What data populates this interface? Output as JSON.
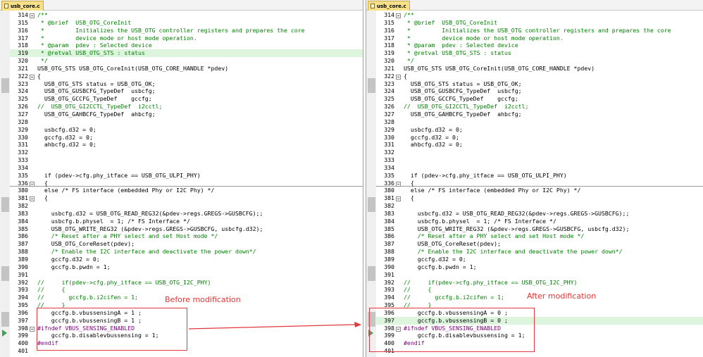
{
  "left_pane": {
    "tab_label": "usb_core.c",
    "lines": [
      {
        "n": "314",
        "text": "/**",
        "cls": "comment",
        "fold": true
      },
      {
        "n": "315",
        "text": " * @brief  USB_OTG_CoreInit",
        "cls": "comment"
      },
      {
        "n": "316",
        "text": " *         Initializes the USB_OTG controller registers and prepares the core",
        "cls": "comment"
      },
      {
        "n": "317",
        "text": " *         device mode or host mode operation.",
        "cls": "comment"
      },
      {
        "n": "318",
        "text": " * @param  pdev : Selected device",
        "cls": "comment"
      },
      {
        "n": "319",
        "text": " * @retval USB_OTG_STS : status",
        "cls": "comment",
        "hl": true
      },
      {
        "n": "320",
        "text": " */",
        "cls": "comment"
      },
      {
        "n": "321",
        "text": "USB_OTG_STS USB_OTG_CoreInit(USB_OTG_CORE_HANDLE *pdev)",
        "cls": ""
      },
      {
        "n": "322",
        "text": "{",
        "cls": "",
        "fold": true
      },
      {
        "n": "323",
        "text": "  USB_OTG_STS status = USB_OTG_OK;",
        "cls": ""
      },
      {
        "n": "324",
        "text": "  USB_OTG_GUSBCFG_TypeDef  usbcfg;",
        "cls": ""
      },
      {
        "n": "325",
        "text": "  USB_OTG_GCCFG_TypeDef    gccfg;",
        "cls": ""
      },
      {
        "n": "326",
        "text": "//  USB_OTG_GI2CCTL_TypeDef  i2cctl;",
        "cls": "comment"
      },
      {
        "n": "327",
        "text": "  USB_OTG_GAHBCFG_TypeDef  ahbcfg;",
        "cls": ""
      },
      {
        "n": "328",
        "text": "",
        "cls": ""
      },
      {
        "n": "329",
        "text": "  usbcfg.d32 = 0;",
        "cls": ""
      },
      {
        "n": "330",
        "text": "  gccfg.d32 = 0;",
        "cls": ""
      },
      {
        "n": "331",
        "text": "  ahbcfg.d32 = 0;",
        "cls": ""
      },
      {
        "n": "332",
        "text": "",
        "cls": ""
      },
      {
        "n": "333",
        "text": "",
        "cls": ""
      },
      {
        "n": "334",
        "text": "",
        "cls": ""
      },
      {
        "n": "335",
        "text": "  if (pdev->cfg.phy_itface == USB_OTG_ULPI_PHY)",
        "cls": ""
      },
      {
        "n": "336",
        "text": "  {",
        "cls": "",
        "fold": true,
        "sep": true
      },
      {
        "n": "380",
        "text": "  else /* FS interface (embedded Phy or I2C Phy) */",
        "cls": ""
      },
      {
        "n": "381",
        "text": "  {",
        "cls": "",
        "fold": true
      },
      {
        "n": "382",
        "text": "",
        "cls": ""
      },
      {
        "n": "383",
        "text": "    usbcfg.d32 = USB_OTG_READ_REG32(&pdev->regs.GREGS->GUSBCFG);;",
        "cls": ""
      },
      {
        "n": "384",
        "text": "    usbcfg.b.physel  = 1; /* FS Interface */",
        "cls": ""
      },
      {
        "n": "385",
        "text": "    USB_OTG_WRITE_REG32 (&pdev->regs.GREGS->GUSBCFG, usbcfg.d32);",
        "cls": ""
      },
      {
        "n": "386",
        "text": "    /* Reset after a PHY select and set Host mode */",
        "cls": "comment"
      },
      {
        "n": "387",
        "text": "    USB_OTG_CoreReset(pdev);",
        "cls": ""
      },
      {
        "n": "388",
        "text": "    /* Enable the I2C interface and deactivate the power down*/",
        "cls": "comment"
      },
      {
        "n": "389",
        "text": "    gccfg.d32 = 0;",
        "cls": ""
      },
      {
        "n": "390",
        "text": "    gccfg.b.pwdn = 1;",
        "cls": ""
      },
      {
        "n": "391",
        "text": "",
        "cls": ""
      },
      {
        "n": "392",
        "text": "//     if(pdev->cfg.phy_itface == USB_OTG_I2C_PHY)",
        "cls": "comment"
      },
      {
        "n": "393",
        "text": "//     {",
        "cls": "comment"
      },
      {
        "n": "394",
        "text": "//       gccfg.b.i2cifen = 1;",
        "cls": "comment"
      },
      {
        "n": "395",
        "text": "//     }",
        "cls": "comment"
      },
      {
        "n": "396",
        "text": "    gccfg.b.vbussensingA = 1 ;",
        "cls": ""
      },
      {
        "n": "397",
        "text": "    gccfg.b.vbussensingB = 1 ;",
        "cls": ""
      },
      {
        "n": "398",
        "text": "#ifndef VBUS_SENSING_ENABLED",
        "cls": "preproc",
        "fold": true
      },
      {
        "n": "399",
        "text": "    gccfg.b.disablevbussensing = 1;",
        "cls": ""
      },
      {
        "n": "400",
        "text": "#endif",
        "cls": "preproc"
      },
      {
        "n": "401",
        "text": "",
        "cls": ""
      }
    ],
    "annotation": "Before modification"
  },
  "right_pane": {
    "tab_label": "usb_core.c",
    "lines": [
      {
        "n": "314",
        "text": "/**",
        "cls": "comment",
        "fold": true
      },
      {
        "n": "315",
        "text": " * @brief  USB_OTG_CoreInit",
        "cls": "comment"
      },
      {
        "n": "316",
        "text": " *         Initializes the USB_OTG controller registers and prepares the core",
        "cls": "comment"
      },
      {
        "n": "317",
        "text": " *         device mode or host mode operation.",
        "cls": "comment"
      },
      {
        "n": "318",
        "text": " * @param  pdev : Selected device",
        "cls": "comment"
      },
      {
        "n": "319",
        "text": " * @retval USB_OTG_STS : status",
        "cls": "comment"
      },
      {
        "n": "320",
        "text": " */",
        "cls": "comment"
      },
      {
        "n": "321",
        "text": "USB_OTG_STS USB_OTG_CoreInit(USB_OTG_CORE_HANDLE *pdev)",
        "cls": ""
      },
      {
        "n": "322",
        "text": "{",
        "cls": "",
        "fold": true
      },
      {
        "n": "323",
        "text": "  USB_OTG_STS status = USB_OTG_OK;",
        "cls": ""
      },
      {
        "n": "324",
        "text": "  USB_OTG_GUSBCFG_TypeDef  usbcfg;",
        "cls": ""
      },
      {
        "n": "325",
        "text": "  USB_OTG_GCCFG_TypeDef    gccfg;",
        "cls": ""
      },
      {
        "n": "326",
        "text": "//  USB_OTG_GI2CCTL_TypeDef  i2cctl;",
        "cls": "comment"
      },
      {
        "n": "327",
        "text": "  USB_OTG_GAHBCFG_TypeDef  ahbcfg;",
        "cls": ""
      },
      {
        "n": "328",
        "text": "",
        "cls": ""
      },
      {
        "n": "329",
        "text": "  usbcfg.d32 = 0;",
        "cls": ""
      },
      {
        "n": "330",
        "text": "  gccfg.d32 = 0;",
        "cls": ""
      },
      {
        "n": "331",
        "text": "  ahbcfg.d32 = 0;",
        "cls": ""
      },
      {
        "n": "332",
        "text": "",
        "cls": ""
      },
      {
        "n": "333",
        "text": "",
        "cls": ""
      },
      {
        "n": "334",
        "text": "",
        "cls": ""
      },
      {
        "n": "335",
        "text": "  if (pdev->cfg.phy_itface == USB_OTG_ULPI_PHY)",
        "cls": ""
      },
      {
        "n": "336",
        "text": "  {",
        "cls": "",
        "fold": true,
        "sep": true
      },
      {
        "n": "380",
        "text": "  else /* FS interface (embedded Phy or I2C Phy) */",
        "cls": ""
      },
      {
        "n": "381",
        "text": "  {",
        "cls": "",
        "fold": true
      },
      {
        "n": "382",
        "text": "",
        "cls": ""
      },
      {
        "n": "383",
        "text": "    usbcfg.d32 = USB_OTG_READ_REG32(&pdev->regs.GREGS->GUSBCFG);;",
        "cls": ""
      },
      {
        "n": "384",
        "text": "    usbcfg.b.physel  = 1; /* FS Interface */",
        "cls": ""
      },
      {
        "n": "385",
        "text": "    USB_OTG_WRITE_REG32 (&pdev->regs.GREGS->GUSBCFG, usbcfg.d32);",
        "cls": ""
      },
      {
        "n": "386",
        "text": "    /* Reset after a PHY select and set Host mode */",
        "cls": "comment"
      },
      {
        "n": "387",
        "text": "    USB_OTG_CoreReset(pdev);",
        "cls": ""
      },
      {
        "n": "388",
        "text": "    /* Enable the I2C interface and deactivate the power down*/",
        "cls": "comment"
      },
      {
        "n": "389",
        "text": "    gccfg.d32 = 0;",
        "cls": ""
      },
      {
        "n": "390",
        "text": "    gccfg.b.pwdn = 1;",
        "cls": ""
      },
      {
        "n": "391",
        "text": "",
        "cls": ""
      },
      {
        "n": "392",
        "text": "//     if(pdev->cfg.phy_itface == USB_OTG_I2C_PHY)",
        "cls": "comment"
      },
      {
        "n": "393",
        "text": "//     {",
        "cls": "comment"
      },
      {
        "n": "394",
        "text": "//       gccfg.b.i2cifen = 1;",
        "cls": "comment"
      },
      {
        "n": "395",
        "text": "//     }",
        "cls": "comment"
      },
      {
        "n": "396",
        "text": "    gccfg.b.vbussensingA = 0 ;",
        "cls": ""
      },
      {
        "n": "397",
        "text": "    gccfg.b.vbussensingB = 0 ;",
        "cls": "",
        "hl": true
      },
      {
        "n": "398",
        "text": "#ifndef VBUS_SENSING_ENABLED",
        "cls": "preproc",
        "fold": true
      },
      {
        "n": "399",
        "text": "    gccfg.b.disablevbussensing = 1;",
        "cls": ""
      },
      {
        "n": "400",
        "text": "#endif",
        "cls": "preproc"
      },
      {
        "n": "401",
        "text": "",
        "cls": ""
      }
    ],
    "annotation": "After modification"
  },
  "colors": {
    "annotation": "#e63333",
    "comment": "#008000",
    "preprocessor": "#800080",
    "highlight": "#dcf5dc"
  }
}
